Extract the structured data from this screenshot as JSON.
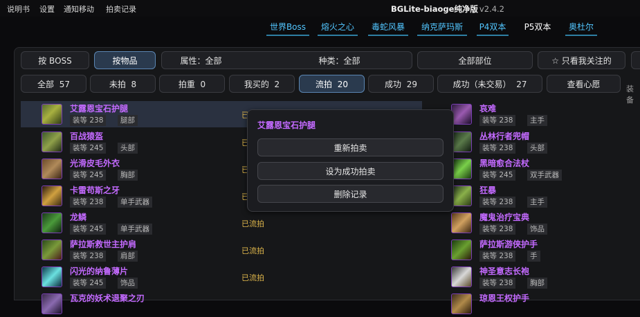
{
  "menu": [
    "说明书",
    "设置",
    "通知移动",
    "拍卖记录"
  ],
  "app": {
    "title": "BGLite-biaoge纯净版",
    "version": "v2.4.2"
  },
  "raids": [
    "世界Boss",
    "熔火之心",
    "毒蛇风暴",
    "纳克萨玛斯",
    "P4双本",
    "P5双本",
    "奥杜尔"
  ],
  "active_raid": "P5双本",
  "filters": {
    "by_boss": "按 BOSS",
    "by_item": "按物品",
    "attr": "属性：全部",
    "kind": "种类：全部",
    "parts": "全部部位",
    "watched": "☆ 只看我关注的"
  },
  "status_tabs": [
    {
      "label": "全部",
      "count": "57"
    },
    {
      "label": "未拍",
      "count": "8"
    },
    {
      "label": "拍重",
      "count": "0"
    },
    {
      "label": "我买的",
      "count": "2"
    },
    {
      "label": "流拍",
      "count": "20"
    },
    {
      "label": "成功",
      "count": "29"
    },
    {
      "label": "成功（未交易）",
      "count": "27"
    }
  ],
  "wish_button": "查看心愿",
  "trailing_text": "装备",
  "left_items": [
    {
      "name": "艾露恩宝石护腿",
      "ilvl": "装等 238",
      "slot": "腿部",
      "status": "已流拍"
    },
    {
      "name": "百战猿盔",
      "ilvl": "装等 245",
      "slot": "头部",
      "status": "已流拍"
    },
    {
      "name": "光滑皮毛外衣",
      "ilvl": "装等 245",
      "slot": "胸部",
      "status": "已流拍"
    },
    {
      "name": "卡雷苟斯之牙",
      "ilvl": "装等 238",
      "slot": "单手武器",
      "status": "已流拍"
    },
    {
      "name": "龙鳞",
      "ilvl": "装等 245",
      "slot": "单手武器",
      "status": "已流拍"
    },
    {
      "name": "萨拉斯救世主护肩",
      "ilvl": "装等 238",
      "slot": "肩部",
      "status": "已流拍"
    },
    {
      "name": "闪光的纳鲁薄片",
      "ilvl": "装等 245",
      "slot": "饰品",
      "status": "已流拍"
    },
    {
      "name": "瓦克的妖术退聚之刃",
      "ilvl": "",
      "slot": "",
      "status": ""
    }
  ],
  "right_items": [
    {
      "name": "哀难",
      "ilvl": "装等 238",
      "slot": "主手"
    },
    {
      "name": "丛林行者兜帽",
      "ilvl": "装等 238",
      "slot": "头部"
    },
    {
      "name": "黑暗愈合法杖",
      "ilvl": "装等 245",
      "slot": "双手武器"
    },
    {
      "name": "狂暴",
      "ilvl": "装等 238",
      "slot": "主手"
    },
    {
      "name": "魔鬼治疗宝典",
      "ilvl": "装等 238",
      "slot": "饰品"
    },
    {
      "name": "萨拉斯游侠护手",
      "ilvl": "装等 238",
      "slot": "手"
    },
    {
      "name": "神圣意志长袍",
      "ilvl": "装等 238",
      "slot": "胸部"
    },
    {
      "name": "琼恩王权护手",
      "ilvl": "",
      "slot": ""
    }
  ],
  "popup": {
    "title": "艾露恩宝石护腿",
    "rebid": "重新拍卖",
    "set_success": "设为成功拍卖",
    "delete": "删除记录"
  },
  "colors": {
    "accent": "#52c6ff",
    "item_purple": "#c36aff",
    "status_gold": "#e1b84c"
  }
}
